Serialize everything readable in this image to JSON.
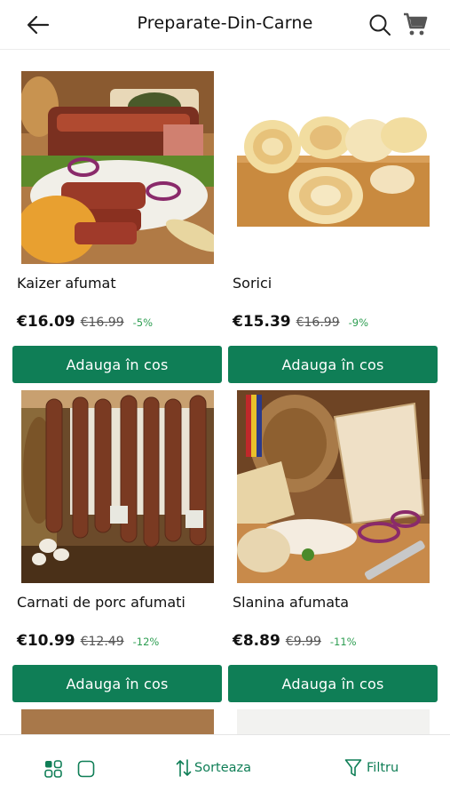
{
  "header": {
    "title": "Preparate-Din-Carne",
    "back_icon": "arrow-left-icon",
    "search_icon": "search-icon",
    "cart_icon": "cart-icon"
  },
  "products": [
    {
      "name": "Kaizer afumat",
      "price": "€16.09",
      "old_price": "€16.99",
      "discount": "-5%",
      "button": "Adauga în cos"
    },
    {
      "name": "Sorici",
      "price": "€15.39",
      "old_price": "€16.99",
      "discount": "-9%",
      "button": "Adauga în cos"
    },
    {
      "name": "Carnati de porc afumati",
      "price": "€10.99",
      "old_price": "€12.49",
      "discount": "-12%",
      "button": "Adauga în cos"
    },
    {
      "name": "Slanina afumata",
      "price": "€8.89",
      "old_price": "€9.99",
      "discount": "-11%",
      "button": "Adauga în cos"
    }
  ],
  "footer": {
    "sort_label": "Sorteaza",
    "filter_label": "Filtru"
  },
  "colors": {
    "accent": "#0f7e56",
    "discount": "#2e9e52"
  }
}
